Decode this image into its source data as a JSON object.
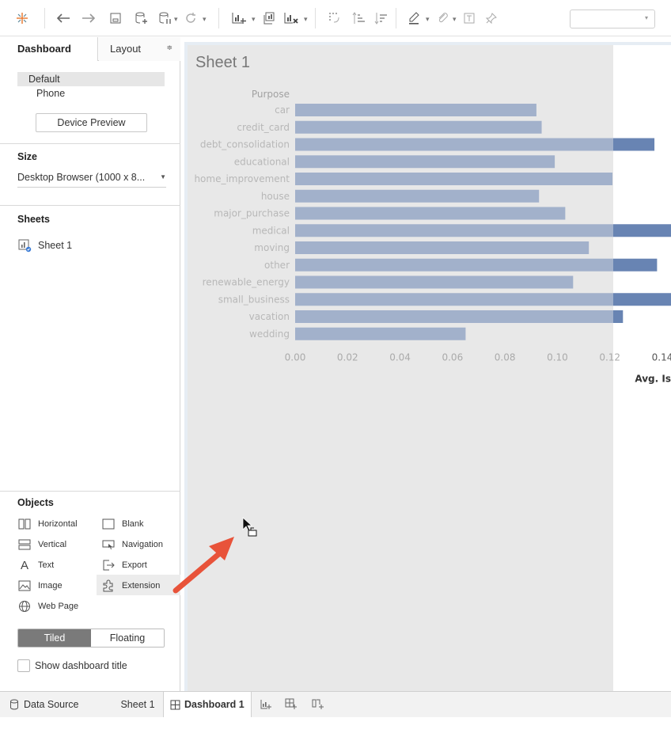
{
  "toolbar": {
    "tooltip_combo_value": "",
    "icons": [
      "tableau-logo-icon",
      "back-icon",
      "forward-icon",
      "save-icon",
      "new-datasource-icon",
      "pause-datasource-icon",
      "refresh-icon",
      "new-worksheet-icon",
      "duplicate-icon",
      "clear-sheet-icon",
      "swap-icon",
      "sort-asc-icon",
      "sort-desc-icon",
      "highlight-icon",
      "group-icon",
      "label-icon",
      "pin-icon"
    ]
  },
  "left_panel": {
    "tabs": {
      "dashboard": "Dashboard",
      "layout": "Layout"
    },
    "devices": {
      "default": "Default",
      "phone": "Phone",
      "preview_button": "Device Preview"
    },
    "size": {
      "title": "Size",
      "value": "Desktop Browser (1000 x 8..."
    },
    "sheets": {
      "title": "Sheets",
      "items": [
        {
          "label": "Sheet 1"
        }
      ]
    },
    "objects": {
      "title": "Objects",
      "items": [
        {
          "label": "Horizontal",
          "icon": "horizontal-container-icon"
        },
        {
          "label": "Blank",
          "icon": "blank-icon"
        },
        {
          "label": "Vertical",
          "icon": "vertical-container-icon"
        },
        {
          "label": "Navigation",
          "icon": "navigation-icon"
        },
        {
          "label": "Text",
          "icon": "text-icon"
        },
        {
          "label": "Export",
          "icon": "export-icon"
        },
        {
          "label": "Image",
          "icon": "image-icon"
        },
        {
          "label": "Extension",
          "icon": "extension-icon"
        },
        {
          "label": "Web Page",
          "icon": "web-page-icon"
        }
      ]
    },
    "layout_mode": {
      "tiled": "Tiled",
      "floating": "Floating",
      "selected": "Tiled"
    },
    "show_title": {
      "label": "Show dashboard title",
      "checked": false
    }
  },
  "canvas": {
    "sheet_title": "Sheet 1"
  },
  "chart_data": {
    "type": "bar",
    "orientation": "horizontal",
    "row_header": "Purpose",
    "categories": [
      "car",
      "credit_card",
      "debt_consolidation",
      "educational",
      "home_improvement",
      "house",
      "major_purchase",
      "medical",
      "moving",
      "other",
      "renewable_energy",
      "small_business",
      "vacation",
      "wedding"
    ],
    "values": [
      0.092,
      0.094,
      0.137,
      0.099,
      0.121,
      0.093,
      0.103,
      0.146,
      0.112,
      0.138,
      0.106,
      0.146,
      0.125,
      0.065
    ],
    "xticks": [
      "0.00",
      "0.02",
      "0.04",
      "0.06",
      "0.08",
      "0.10",
      "0.12",
      "0.14"
    ],
    "xlim": [
      0,
      0.14
    ],
    "xlabel": "Avg. Is",
    "bar_color": "#6884b3",
    "grid": false
  },
  "bottom_bar": {
    "tabs": [
      {
        "label": "Data Source",
        "icon": "datasource-icon"
      },
      {
        "label": "Sheet 1"
      },
      {
        "label": "Dashboard 1",
        "icon": "dashboard-icon",
        "active": true
      }
    ],
    "new_tab_icons": [
      "new-sheet-icon",
      "new-dashboard-icon",
      "new-story-icon"
    ]
  },
  "annotation": {
    "arrow_color": "#e8533a"
  }
}
